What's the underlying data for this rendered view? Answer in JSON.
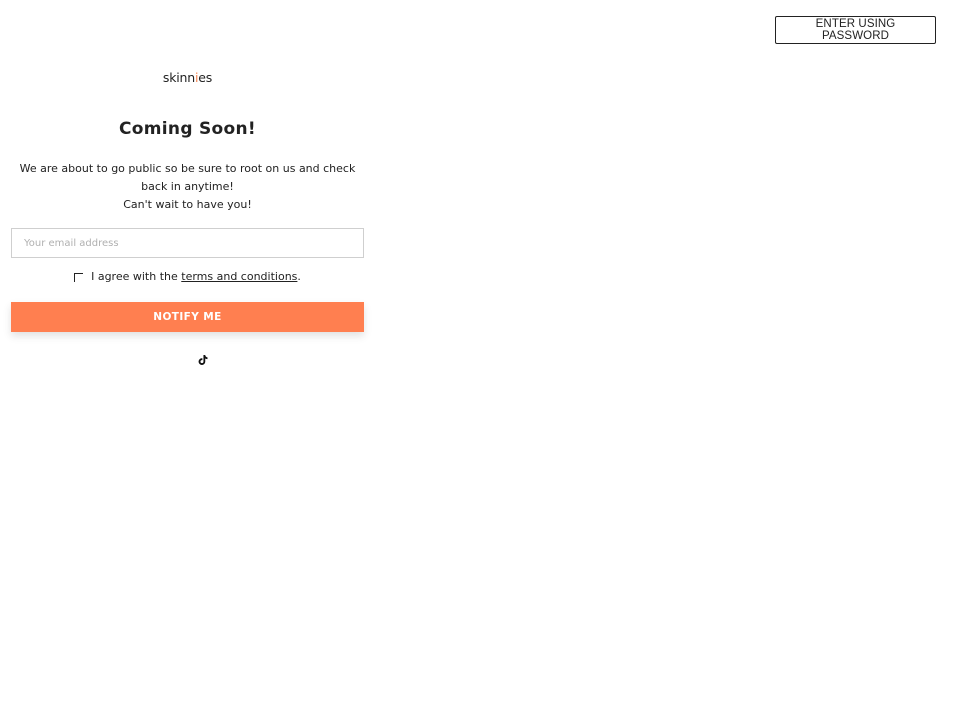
{
  "header": {
    "password_button_label": "ENTER USING PASSWORD"
  },
  "brand": {
    "logo_text_before": "skinn",
    "logo_text_accent": "i",
    "logo_text_after": "es",
    "accent_color": "#f5834f"
  },
  "content": {
    "title": "Coming Soon!",
    "description_line1": "We are about to go public so be sure to root on us and check back in anytime!",
    "description_line2": "Can't wait to have you!"
  },
  "form": {
    "email_value": "",
    "email_placeholder": "Your email address",
    "agree_prefix": "I agree with the ",
    "terms_link_text": "terms and conditions",
    "agree_suffix": ".",
    "agree_checked": false,
    "submit_label": "NOTIFY ME",
    "submit_color": "#ff7f50"
  },
  "social": {
    "icons": [
      "tiktok-icon"
    ]
  }
}
